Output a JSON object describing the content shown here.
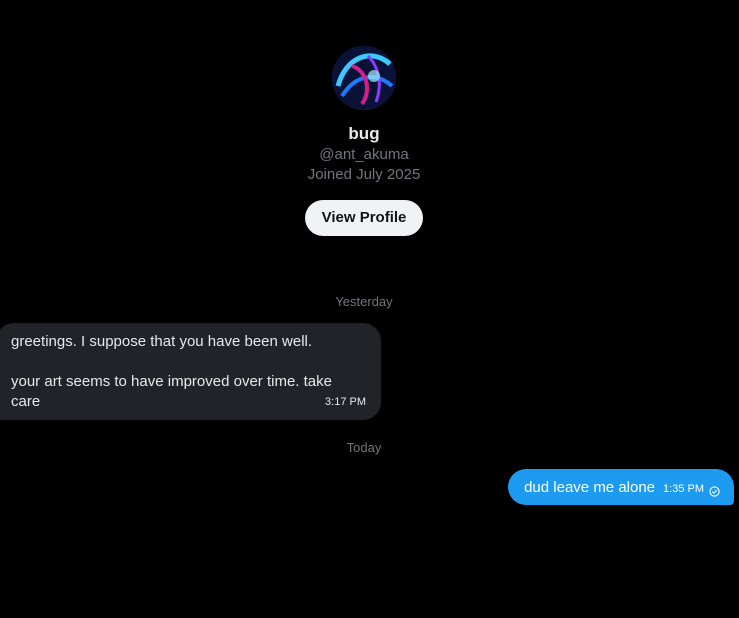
{
  "profile": {
    "name": "bug",
    "handle": "@ant_akuma",
    "joined": "Joined July 2025",
    "view_profile_label": "View Profile"
  },
  "conversation": {
    "separators": [
      "Yesterday",
      "Today"
    ],
    "messages": [
      {
        "direction": "incoming",
        "lines": [
          "greetings. I suppose that you have been well.",
          "",
          "your art seems to have improved over time. take",
          "care"
        ],
        "time": "3:17 PM"
      },
      {
        "direction": "outgoing",
        "text": "dud leave me alone",
        "time": "1:35 PM",
        "status_icon": "sent-check-icon"
      }
    ]
  },
  "colors": {
    "background": "#000000",
    "incoming_bubble": "#202327",
    "outgoing_bubble": "#1d9bf0",
    "secondary_text": "#71767b"
  }
}
